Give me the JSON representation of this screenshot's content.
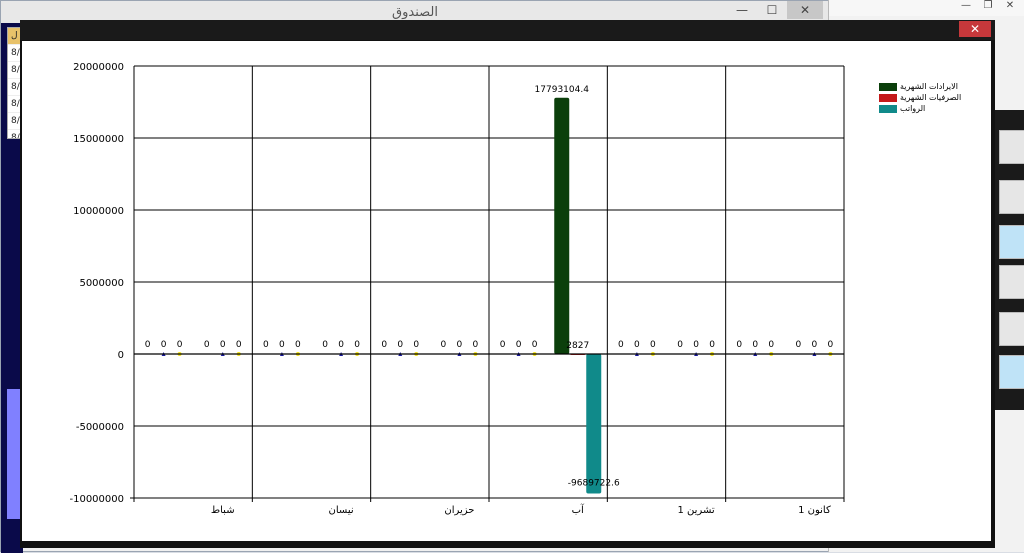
{
  "background_window": {
    "title": "الصندوق",
    "controls": {
      "minimize": "—",
      "maximize": "☐",
      "close": "✕"
    },
    "list_rows": [
      "ل",
      "8/",
      "8/",
      "8/",
      "8/",
      "8/",
      "8/"
    ]
  },
  "right_window": {
    "controls": {
      "minimize": "—",
      "restore": "❐",
      "close": "✕"
    }
  },
  "chart_window": {
    "close": "✕"
  },
  "colors": {
    "revenue": "#0b3f0b",
    "expenses": "#c41a1a",
    "salaries": "#108a8a",
    "marker_blue": "#1a1aa0",
    "marker_yellow": "#f5e51b"
  },
  "chart_data": {
    "type": "bar",
    "ylim": [
      -10000000,
      20000000
    ],
    "yticks": [
      "20000000",
      "15000000",
      "10000000",
      "5000000",
      "0",
      "-5000000",
      "-10000000"
    ],
    "ytick_values": [
      20000000,
      15000000,
      10000000,
      5000000,
      0,
      -5000000,
      -10000000
    ],
    "x_category_labels": [
      "شباط",
      "نيسان",
      "حزيران",
      "آب",
      "تشرين 1",
      "كانون 1"
    ],
    "months_count": 12,
    "legend_position": "top-right",
    "grid": true,
    "series": [
      {
        "name": "الايرادات الشهرية",
        "color": "#0b3f0b",
        "values": [
          0,
          0,
          0,
          0,
          0,
          0,
          0,
          17793104.4,
          0,
          0,
          0,
          0
        ],
        "labels": [
          "0",
          "0",
          "0",
          "0",
          "0",
          "0",
          "0",
          "17793104.4",
          "0",
          "0",
          "0",
          "0"
        ]
      },
      {
        "name": "الصرفيات الشهرية",
        "color": "#c41a1a",
        "values": [
          0,
          0,
          0,
          0,
          0,
          0,
          0,
          2827,
          0,
          0,
          0,
          0
        ],
        "labels": [
          "0",
          "0",
          "0",
          "0",
          "0",
          "0",
          "0",
          "2827",
          "0",
          "0",
          "0",
          "0"
        ]
      },
      {
        "name": "الرواتب",
        "color": "#108a8a",
        "values": [
          0,
          0,
          0,
          0,
          0,
          0,
          0,
          -9689722.6,
          0,
          0,
          0,
          0
        ],
        "labels": [
          "0",
          "0",
          "0",
          "0",
          "0",
          "0",
          "0",
          "-9689722.6",
          "0",
          "0",
          "0",
          "0"
        ]
      }
    ]
  }
}
